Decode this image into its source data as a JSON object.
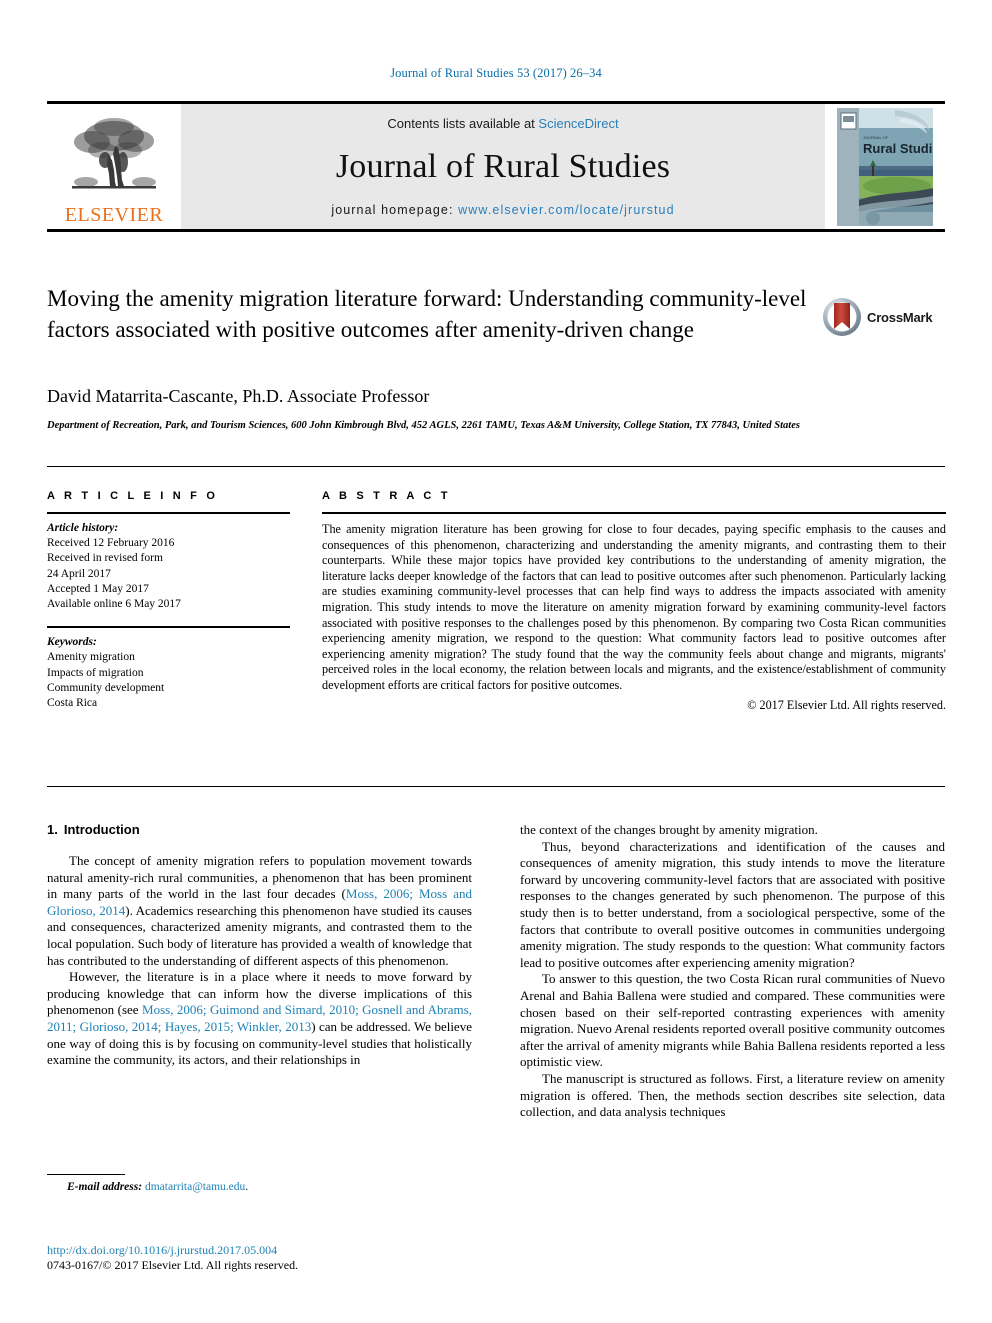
{
  "running_head": "Journal of Rural Studies 53 (2017) 26–34",
  "masthead": {
    "publisher_name": "ELSEVIER",
    "contents_prefix": "Contents lists available at ",
    "contents_link": "ScienceDirect",
    "journal_title": "Journal of Rural Studies",
    "homepage_prefix": "journal homepage: ",
    "homepage_url": "www.elsevier.com/locate/jrurstud",
    "cover_title_small": "JOURNAL OF",
    "cover_title": "Rural Studies"
  },
  "article": {
    "title": "Moving the amenity migration literature forward: Understanding community-level factors associated with positive outcomes after amenity-driven change",
    "crossmark_label": "CrossMark",
    "author": "David Matarrita-Cascante, Ph.D. Associate Professor",
    "affiliation": "Department of Recreation, Park, and Tourism Sciences, 600 John Kimbrough Blvd, 452 AGLS, 2261 TAMU, Texas A&M University, College Station, TX 77843, United States"
  },
  "article_info": {
    "heading": "A R T I C L E   I N F O",
    "history_label": "Article history:",
    "history": [
      "Received 12 February 2016",
      "Received in revised form",
      "24 April 2017",
      "Accepted 1 May 2017",
      "Available online 6 May 2017"
    ],
    "keywords_label": "Keywords:",
    "keywords": [
      "Amenity migration",
      "Impacts of migration",
      "Community development",
      "Costa Rica"
    ]
  },
  "abstract": {
    "heading": "A B S T R A C T",
    "text": "The amenity migration literature has been growing for close to four decades, paying specific emphasis to the causes and consequences of this phenomenon, characterizing and understanding the amenity migrants, and contrasting them to their counterparts. While these major topics have provided key contributions to the understanding of amenity migration, the literature lacks deeper knowledge of the factors that can lead to positive outcomes after such phenomenon. Particularly lacking are studies examining community-level processes that can help find ways to address the impacts associated with amenity migration. This study intends to move the literature on amenity migration forward by examining community-level factors associated with positive responses to the challenges posed by this phenomenon. By comparing two Costa Rican communities experiencing amenity migration, we respond to the question: What community factors lead to positive outcomes after experiencing amenity migration? The study found that the way the community feels about change and migrants, migrants' perceived roles in the local economy, the relation between locals and migrants, and the existence/establishment of community development efforts are critical factors for positive outcomes.",
    "copyright": "© 2017 Elsevier Ltd. All rights reserved."
  },
  "body": {
    "section_number": "1.",
    "section_title": "Introduction",
    "left_paragraphs": [
      {
        "parts": [
          {
            "t": "The concept of amenity migration refers to population movement towards natural amenity-rich rural communities, a phenomenon that has been prominent in many parts of the world in the last four decades (",
            "ref": false
          },
          {
            "t": "Moss, 2006; Moss and Glorioso, 2014",
            "ref": true
          },
          {
            "t": "). Academics researching this phenomenon have studied its causes and consequences, characterized amenity migrants, and contrasted them to the local population. Such body of literature has provided a wealth of knowledge that has contributed to the understanding of different aspects of this phenomenon.",
            "ref": false
          }
        ]
      },
      {
        "parts": [
          {
            "t": "However, the literature is in a place where it needs to move forward by producing knowledge that can inform how the diverse implications of this phenomenon (see ",
            "ref": false
          },
          {
            "t": "Moss, 2006; Guimond and Simard, 2010; Gosnell and Abrams, 2011; Glorioso, 2014; Hayes, 2015; Winkler, 2013",
            "ref": true
          },
          {
            "t": ") can be addressed. We believe one way of doing this is by focusing on community-level studies that holistically examine the community, its actors, and their relationships in",
            "ref": false
          }
        ]
      }
    ],
    "right_paragraphs": [
      {
        "indent": false,
        "parts": [
          {
            "t": "the context of the changes brought by amenity migration.",
            "ref": false
          }
        ]
      },
      {
        "indent": true,
        "parts": [
          {
            "t": "Thus, beyond characterizations and identification of the causes and consequences of amenity migration, this study intends to move the literature forward by uncovering community-level factors that are associated with positive responses to the changes generated by such phenomenon. The purpose of this study then is to better understand, from a sociological perspective, some of the factors that contribute to overall positive outcomes in communities undergoing amenity migration. The study responds to the question: What community factors lead to positive outcomes after experiencing amenity migration?",
            "ref": false
          }
        ]
      },
      {
        "indent": true,
        "parts": [
          {
            "t": "To answer to this question, the two Costa Rican rural communities of Nuevo Arenal and Bahia Ballena were studied and compared. These communities were chosen based on their self-reported contrasting experiences with amenity migration. Nuevo Arenal residents reported overall positive community outcomes after the arrival of amenity migrants while Bahia Ballena residents reported a less optimistic view.",
            "ref": false
          }
        ]
      },
      {
        "indent": true,
        "parts": [
          {
            "t": "The manuscript is structured as follows. First, a literature review on amenity migration is offered. Then, the methods section describes site selection, data collection, and data analysis techniques",
            "ref": false
          }
        ]
      }
    ]
  },
  "footnote": {
    "label": "E-mail address:",
    "email": "dmatarrita@tamu.edu",
    "trailing": "."
  },
  "footer": {
    "doi": "http://dx.doi.org/10.1016/j.jrurstud.2017.05.004",
    "issn_line": "0743-0167/© 2017 Elsevier Ltd. All rights reserved."
  },
  "colors": {
    "link_blue": "#1f82b5",
    "elsevier_orange": "#E9711C",
    "masthead_grey": "#e8e8e8",
    "crossmark_red": "#C0342B"
  }
}
